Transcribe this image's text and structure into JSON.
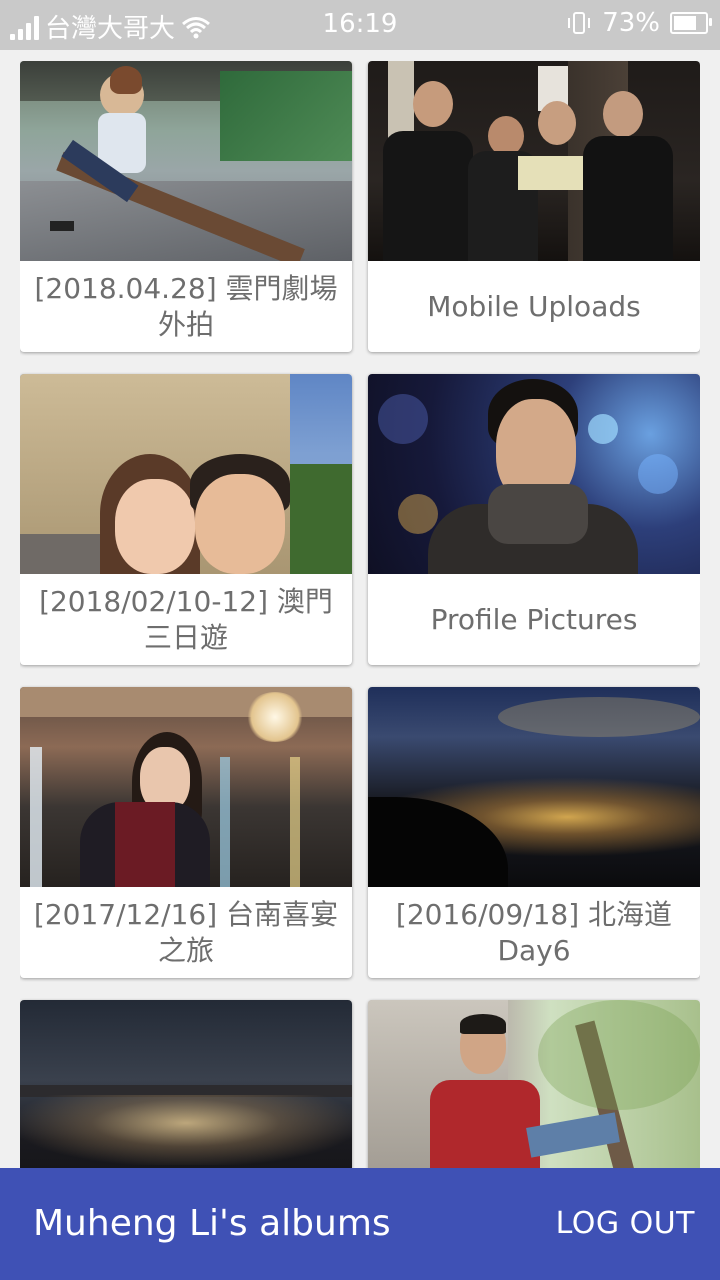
{
  "status_bar": {
    "carrier": "台灣大哥大",
    "time": "16:19",
    "battery_percent": "73%",
    "battery_level": 0.73,
    "icons": [
      "signal-icon",
      "wifi-icon",
      "vibrate-icon",
      "battery-icon"
    ]
  },
  "albums": [
    {
      "title": "[2018.04.28] 雲門劇場外拍",
      "photo": "woman-on-bench-photo"
    },
    {
      "title": "Mobile Uploads",
      "photo": "group-photo"
    },
    {
      "title": "[2018/02/10-12] 澳門三日遊",
      "photo": "couple-selfie-photo"
    },
    {
      "title": "Profile Pictures",
      "photo": "man-portrait-photo"
    },
    {
      "title": "[2017/12/16] 台南喜宴之旅",
      "photo": "woman-night-lights-photo"
    },
    {
      "title": "[2016/09/18] 北海道Day6",
      "photo": "night-city-view-photo"
    },
    {
      "title": "",
      "photo": "city-night-skyline-photo"
    },
    {
      "title": "",
      "photo": "man-sitting-tree-photo"
    }
  ],
  "app_bar": {
    "title": "Muheng Li's albums",
    "logout_label": "LOG OUT"
  },
  "colors": {
    "app_bar": "#3f51b5",
    "status_bar": "#c9c9c9",
    "caption_text": "#6e6e6e"
  }
}
